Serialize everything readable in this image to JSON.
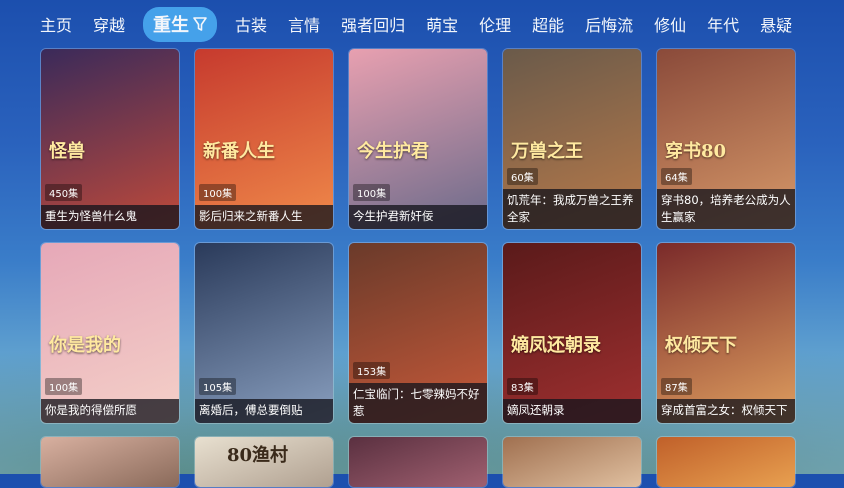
{
  "nav": {
    "items": [
      "主页",
      "穿越",
      "重生",
      "古装",
      "言情",
      "强者回归",
      "萌宝",
      "伦理",
      "超能",
      "后悔流",
      "修仙",
      "年代",
      "悬疑"
    ],
    "active_index": 2
  },
  "cards": [
    {
      "title": "重生为怪兽什么鬼",
      "episodes": "450集",
      "colors": [
        "#3a2a5a",
        "#c04a3a"
      ],
      "poster_text": "怪兽"
    },
    {
      "title": "影后归来之新番人生",
      "episodes": "100集",
      "colors": [
        "#c63a2e",
        "#f08a4a"
      ],
      "poster_text": "新番人生"
    },
    {
      "title": "今生护君新奸佞",
      "episodes": "100集",
      "colors": [
        "#e8a0b0",
        "#6a6a8a"
      ],
      "poster_text": "今生护君"
    },
    {
      "title": "饥荒年：我成万兽之王养全家",
      "episodes": "60集",
      "colors": [
        "#6a5a4a",
        "#b87a4a"
      ],
      "poster_text": "万兽之王"
    },
    {
      "title": "穿书80，培养老公成为人生赢家",
      "episodes": "64集",
      "colors": [
        "#8a4a3a",
        "#d89a6a"
      ],
      "poster_text": "穿书80"
    },
    {
      "title": "你是我的得偿所愿",
      "episodes": "100集",
      "colors": [
        "#e6a8b8",
        "#f4d0c8"
      ],
      "poster_text": "你是我的"
    },
    {
      "title": "离婚后，傅总要倒贴",
      "episodes": "105集",
      "colors": [
        "#2a3a5a",
        "#8aa0c0"
      ],
      "poster_text": ""
    },
    {
      "title": "仁宝临门：七零辣妈不好惹",
      "episodes": "153集",
      "colors": [
        "#6a3a2a",
        "#c85a3a"
      ],
      "poster_text": ""
    },
    {
      "title": "嫡凤还朝录",
      "episodes": "83集",
      "colors": [
        "#5a1a1a",
        "#a03030"
      ],
      "poster_text": "嫡凤还朝录"
    },
    {
      "title": "穿成首富之女：权倾天下",
      "episodes": "87集",
      "colors": [
        "#7a2a2a",
        "#e0a060"
      ],
      "poster_text": "权倾天下"
    },
    {
      "title": "",
      "episodes": "",
      "colors": [
        "#d8b0a0",
        "#8a6a5a"
      ],
      "poster_text": ""
    },
    {
      "title": "",
      "episodes": "",
      "colors": [
        "#e8e0d0",
        "#b0a090"
      ],
      "poster_text": "80渔村"
    },
    {
      "title": "",
      "episodes": "",
      "colors": [
        "#5a3040",
        "#a06070"
      ],
      "poster_text": ""
    },
    {
      "title": "",
      "episodes": "",
      "colors": [
        "#a07050",
        "#e0c0a0"
      ],
      "poster_text": ""
    },
    {
      "title": "",
      "episodes": "",
      "colors": [
        "#c0602a",
        "#e8a050"
      ],
      "poster_text": ""
    }
  ]
}
